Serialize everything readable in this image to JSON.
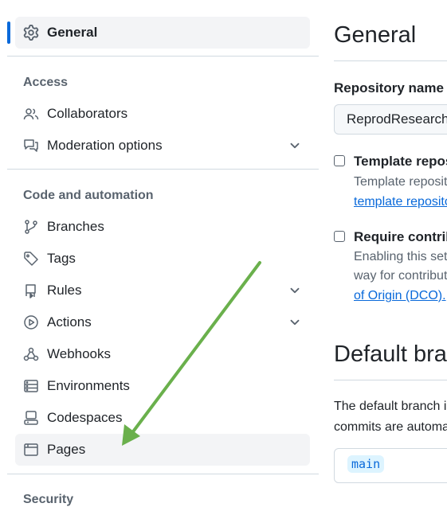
{
  "sidebar": {
    "general": {
      "label": "General",
      "icon": "gear-icon"
    },
    "access_heading": "Access",
    "access_items": [
      {
        "label": "Collaborators",
        "icon": "people-icon"
      },
      {
        "label": "Moderation options",
        "icon": "comment-discussion-icon",
        "expandable": true
      }
    ],
    "code_heading": "Code and automation",
    "code_items": [
      {
        "label": "Branches",
        "icon": "git-branch-icon"
      },
      {
        "label": "Tags",
        "icon": "tag-icon"
      },
      {
        "label": "Rules",
        "icon": "repo-push-icon",
        "expandable": true
      },
      {
        "label": "Actions",
        "icon": "play-icon",
        "expandable": true
      },
      {
        "label": "Webhooks",
        "icon": "webhook-icon"
      },
      {
        "label": "Environments",
        "icon": "server-icon"
      },
      {
        "label": "Codespaces",
        "icon": "codespaces-icon"
      },
      {
        "label": "Pages",
        "icon": "browser-icon",
        "highlighted": true
      }
    ],
    "security_heading": "Security"
  },
  "main": {
    "title": "General",
    "repo_name_label": "Repository name",
    "repo_name_value": "ReprodResearch",
    "template": {
      "title": "Template repository",
      "desc": "Template repositories let users generate new repositories with the same directory structure and files.",
      "link": "template repository",
      "checked": false
    },
    "signoff": {
      "title": "Require contributors to sign off on web-based commits",
      "desc1": "Enabling this setting will require contributors to sign off on commits made through GitHub's web interface. Signing off is a",
      "desc2": "way for contributors to affirm that their commit complies with the repository's terms, commonly the Developer Certificate",
      "link": "of Origin (DCO).",
      "checked": false
    },
    "default_branch_title": "Default branch",
    "default_branch_desc1": "The default branch is considered the \"base\" branch in your repository, against which all pull requests and code",
    "default_branch_desc2": "commits are automatically made, unless you specify a different branch.",
    "default_branch_value": "main"
  },
  "annotation": {
    "color": "#6ab04c",
    "points_to": "Pages"
  },
  "colors": {
    "accent": "#0969da",
    "muted": "#59636e",
    "border": "#d1d9e0",
    "selected_bg": "#f3f4f6"
  }
}
